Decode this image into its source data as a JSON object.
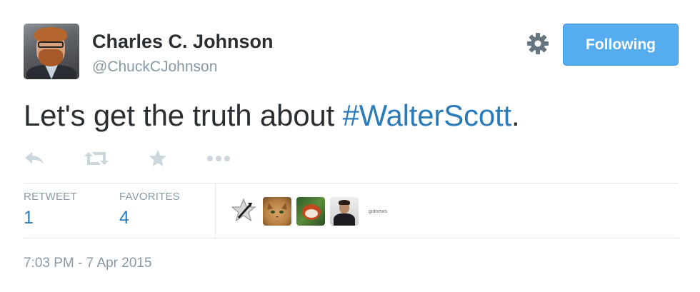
{
  "author": {
    "name": "Charles C. Johnson",
    "handle": "@ChuckCJohnson",
    "avatar_icon": "profile-photo"
  },
  "follow_button": {
    "label": "Following",
    "color": "#55acee"
  },
  "settings_icon": "gear-icon",
  "tweet": {
    "text_before": "Let's get the truth about ",
    "hashtag": "#WalterScott",
    "text_after": ".",
    "hashtag_color": "#2b7bb9"
  },
  "actions": [
    "reply-icon",
    "retweet-icon",
    "favorite-icon",
    "more-icon"
  ],
  "stats": {
    "retweet_label": "RETWEET",
    "retweet_count": "1",
    "favorites_label": "FAVORITES",
    "favorites_count": "4"
  },
  "favoriters": [
    {
      "icon": "star-badge-avatar"
    },
    {
      "icon": "cat-avatar"
    },
    {
      "icon": "red-panda-avatar"
    },
    {
      "icon": "man-in-suit-avatar"
    },
    {
      "label": "gotnews"
    }
  ],
  "timestamp": "7:03 PM - 7 Apr 2015"
}
